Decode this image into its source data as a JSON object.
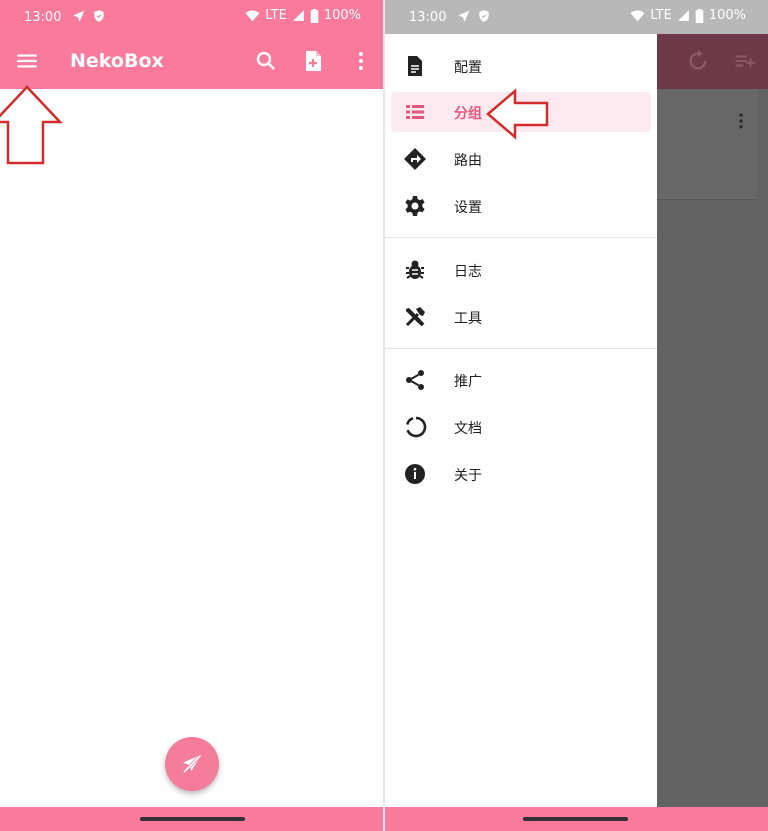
{
  "status_bar": {
    "time": "13:00",
    "network": "LTE",
    "battery": "100%"
  },
  "app": {
    "title": "NekoBox"
  },
  "drawer": {
    "items": [
      {
        "label": "配置",
        "icon": "document-icon"
      },
      {
        "label": "分组",
        "icon": "list-icon",
        "active": true
      },
      {
        "label": "路由",
        "icon": "directions-icon"
      },
      {
        "label": "设置",
        "icon": "gear-icon"
      },
      {
        "label": "日志",
        "icon": "bug-icon"
      },
      {
        "label": "工具",
        "icon": "tools-icon"
      },
      {
        "label": "推广",
        "icon": "share-icon"
      },
      {
        "label": "文档",
        "icon": "docs-ring-icon"
      },
      {
        "label": "关于",
        "icon": "info-icon"
      }
    ]
  },
  "colors": {
    "primary": "#f97a9b",
    "active_text": "#e7577c",
    "active_bg": "#fdeaf0",
    "annotation_arrow": "#d42b2b",
    "scrim": "#636363"
  }
}
